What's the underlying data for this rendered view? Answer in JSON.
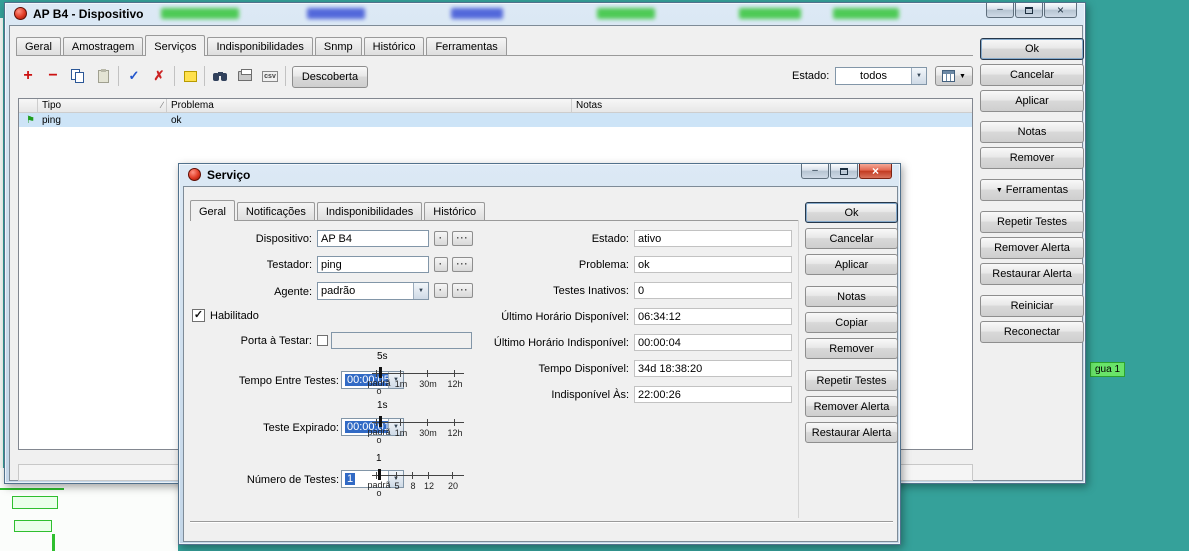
{
  "colors": {
    "desktop_teal": "#35a19a",
    "selection_blue": "#316ac5",
    "row_highlight": "#cde4f7",
    "map_label_green": "#69e469",
    "close_button_red": "#c23a20"
  },
  "icons": {
    "add": "+",
    "remove": "−",
    "check": "✓",
    "cross": "✗",
    "flag": "⚑",
    "dropdown_arrow": "▼",
    "minimize": "–",
    "close": "×",
    "sort": "∕",
    "dot": "·",
    "dots": "···",
    "csv": "csv"
  },
  "desktop": {
    "map_label": "gua 1"
  },
  "main_window": {
    "title": "AP B4 - Dispositivo",
    "tabs": [
      {
        "label": "Geral"
      },
      {
        "label": "Amostragem"
      },
      {
        "label": "Serviços"
      },
      {
        "label": "Indisponibilidades"
      },
      {
        "label": "Snmp"
      },
      {
        "label": "Histórico"
      },
      {
        "label": "Ferramentas"
      }
    ],
    "toolbar": {
      "descoberta_label": "Descoberta",
      "estado_label": "Estado:",
      "estado_value": "todos"
    },
    "table": {
      "columns": [
        "Tipo",
        "Problema",
        "Notas"
      ],
      "rows": [
        {
          "tipo": "ping",
          "problema": "ok",
          "notas": ""
        }
      ]
    },
    "buttons": {
      "ok": "Ok",
      "cancelar": "Cancelar",
      "aplicar": "Aplicar",
      "notas": "Notas",
      "remover": "Remover",
      "ferramentas": "Ferramentas",
      "repetir": "Repetir Testes",
      "remover_alerta": "Remover Alerta",
      "restaurar_alerta": "Restaurar Alerta",
      "reiniciar": "Reiniciar",
      "reconectar": "Reconectar"
    }
  },
  "dialog": {
    "title": "Serviço",
    "tabs": [
      {
        "label": "Geral"
      },
      {
        "label": "Notificações"
      },
      {
        "label": "Indisponibilidades"
      },
      {
        "label": "Histórico"
      }
    ],
    "fields": {
      "dispositivo_label": "Dispositivo:",
      "dispositivo_value": "AP B4",
      "testador_label": "Testador:",
      "testador_value": "ping",
      "agente_label": "Agente:",
      "agente_value": "padrão",
      "habilitado_label": "Habilitado",
      "porta_label": "Porta à Testar:",
      "tempo_label": "Tempo Entre Testes:",
      "tempo_value": "00:00:05",
      "teste_label": "Teste Expirado:",
      "teste_value": "00:00:01",
      "numero_label": "Número de Testes:",
      "numero_value": "1"
    },
    "sliders": {
      "tempo": {
        "value": "5s",
        "ticks": [
          "padrão",
          "1m",
          "30m",
          "12h"
        ]
      },
      "teste": {
        "value": "1s",
        "ticks": [
          "padrão",
          "1m",
          "30m",
          "12h"
        ]
      },
      "numero": {
        "value": "1",
        "ticks": [
          "padrão",
          "5",
          "8",
          "12",
          "20"
        ]
      }
    },
    "info": [
      {
        "label": "Estado:",
        "value": "ativo"
      },
      {
        "label": "Problema:",
        "value": "ok"
      },
      {
        "label": "Testes Inativos:",
        "value": "0"
      },
      {
        "label": "Último Horário Disponível:",
        "value": "06:34:12"
      },
      {
        "label": "Último Horário Indisponível:",
        "value": "00:00:04"
      },
      {
        "label": "Tempo Disponível:",
        "value": "34d 18:38:20"
      },
      {
        "label": "Indisponível Às:",
        "value": "22:00:26"
      }
    ],
    "buttons": {
      "ok": "Ok",
      "cancelar": "Cancelar",
      "aplicar": "Aplicar",
      "notas": "Notas",
      "copiar": "Copiar",
      "remover": "Remover",
      "repetir": "Repetir Testes",
      "remover_alerta": "Remover Alerta",
      "restaurar_alerta": "Restaurar Alerta"
    }
  }
}
